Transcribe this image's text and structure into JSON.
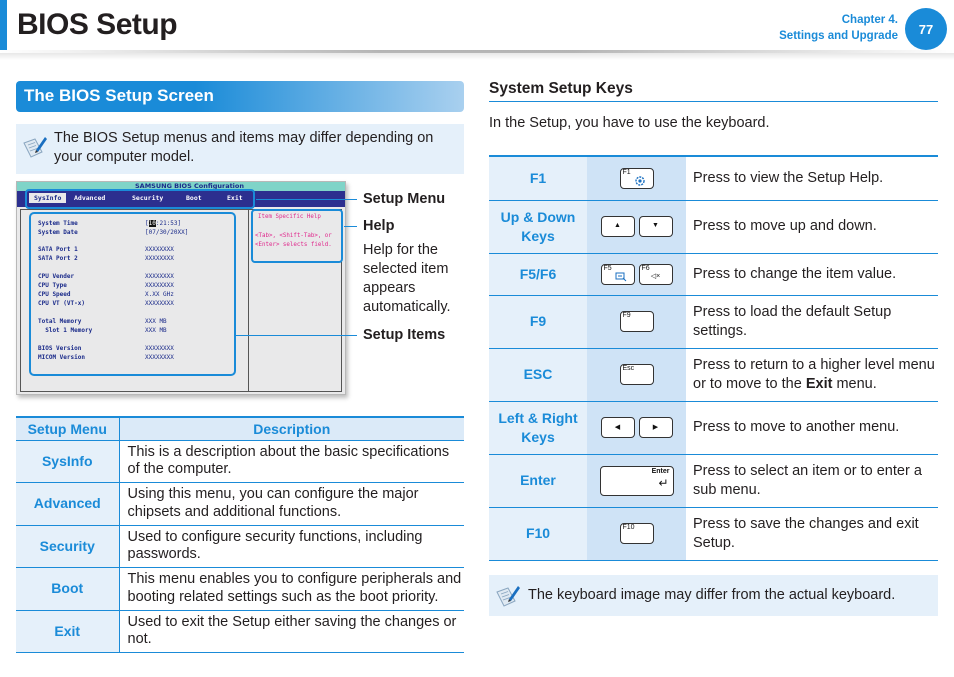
{
  "header": {
    "title": "BIOS Setup",
    "chapter_line1": "Chapter 4.",
    "chapter_line2": "Settings and Upgrade",
    "page_number": "77",
    "accent_color": "#1a8bd8"
  },
  "left": {
    "section_title": "The BIOS Setup Screen",
    "note": {
      "icon": "note-pencil-icon",
      "text": "The BIOS Setup menus and items may differ depending on your computer model."
    },
    "bios_screen": {
      "title": "SAMSUNG BIOS Configuration",
      "menu": [
        "SysInfo",
        "Advanced",
        "Security",
        "Boot",
        "Exit"
      ],
      "active_menu": "SysInfo",
      "items": [
        {
          "label": "System Time",
          "value_cursor": "10",
          "value_rest": ":21:53]",
          "value_prefix": "["
        },
        {
          "label": "System Date",
          "value": "[07/30/20XX]"
        },
        {
          "label": "SATA Port 1",
          "value": "XXXXXXXX"
        },
        {
          "label": "SATA Port 2",
          "value": "XXXXXXXX"
        },
        {
          "label": "CPU Vender",
          "value": "XXXXXXXX"
        },
        {
          "label": "CPU Type",
          "value": "XXXXXXXX"
        },
        {
          "label": "CPU Speed",
          "value": "X.XX GHz"
        },
        {
          "label": "CPU VT (VT-x)",
          "value": "XXXXXXXX"
        },
        {
          "label": "Total Memory",
          "value": "XXX MB"
        },
        {
          "label": "  Slot 1 Memory",
          "value": "XXX MB"
        },
        {
          "label": "BIOS Version",
          "value": "XXXXXXXX"
        },
        {
          "label": "MICOM Version",
          "value": "XXXXXXXX"
        }
      ],
      "help_title": "Item Specific Help",
      "help_text": "<Tab>, <Shift-Tab>, or <Enter> selects field."
    },
    "callouts": {
      "setup_menu": "Setup Menu",
      "help": "Help",
      "help_desc": "Help for the selected item appears automatically.",
      "setup_items": "Setup Items"
    },
    "menu_table": {
      "headers": [
        "Setup Menu",
        "Description"
      ],
      "rows": [
        {
          "menu": "SysInfo",
          "desc": "This is a description about the basic specifications of the computer."
        },
        {
          "menu": "Advanced",
          "desc": "Using this menu, you can configure the major chipsets and additional functions."
        },
        {
          "menu": "Security",
          "desc": "Used to configure security functions, including passwords."
        },
        {
          "menu": "Boot",
          "desc": "This menu enables you to configure peripherals and booting related settings such as the boot priority."
        },
        {
          "menu": "Exit",
          "desc": "Used to exit the Setup either saving the changes or not."
        }
      ]
    }
  },
  "right": {
    "title": "System Setup Keys",
    "intro": "In the Setup, you have to use the keyboard.",
    "keys": [
      {
        "name": "F1",
        "caps": [
          {
            "label": "F1",
            "icon": "help-gear-icon"
          }
        ],
        "desc": "Press to view the Setup Help."
      },
      {
        "name": "Up & Down Keys",
        "caps": [
          {
            "label": "",
            "glyph": "▲",
            "icon": "arrow-up-icon"
          },
          {
            "label": "",
            "glyph": "▼",
            "icon": "arrow-down-icon"
          }
        ],
        "desc": "Press to move up and down."
      },
      {
        "name": "F5/F6",
        "caps": [
          {
            "label": "F5",
            "icon": "display-switch-icon"
          },
          {
            "label": "F6",
            "glyph": "◁×",
            "icon": "mute-icon"
          }
        ],
        "desc": "Press to change the item value."
      },
      {
        "name": "F9",
        "caps": [
          {
            "label": "F9"
          }
        ],
        "desc": "Press to load the default Setup settings."
      },
      {
        "name": "ESC",
        "caps": [
          {
            "label": "Esc"
          }
        ],
        "desc_before": "Press to return to a higher level menu or to move to the ",
        "desc_bold": "Exit",
        "desc_after": " menu."
      },
      {
        "name": "Left & Right Keys",
        "caps": [
          {
            "label": "",
            "glyph": "◀",
            "icon": "arrow-left-icon"
          },
          {
            "label": "",
            "glyph": "▶",
            "icon": "arrow-right-icon"
          }
        ],
        "desc": "Press to move to another menu."
      },
      {
        "name": "Enter",
        "caps": [
          {
            "label": "Enter",
            "glyph": "↵",
            "icon": "enter-icon",
            "wide": true
          }
        ],
        "desc": "Press to select an item or to enter a sub menu."
      },
      {
        "name": "F10",
        "caps": [
          {
            "label": "F10"
          }
        ],
        "desc": "Press to save the changes and exit Setup."
      }
    ],
    "note": {
      "icon": "note-pencil-icon",
      "text": "The keyboard image may differ from the actual keyboard."
    }
  }
}
